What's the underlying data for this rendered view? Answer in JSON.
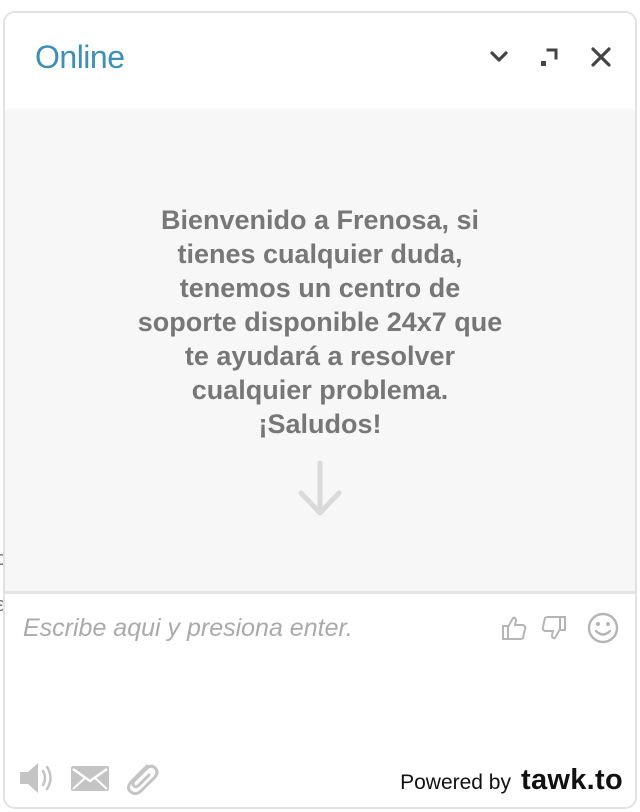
{
  "header": {
    "status": "Online"
  },
  "body": {
    "welcome_message": "Bienvenido a Frenosa, si\ntienes cualquier duda,\ntenemos un centro de\nsoporte disponible 24x7 que\nte ayudará a resolver\ncualquier problema.\n¡Saludos!"
  },
  "composer": {
    "placeholder": "Escribe aqui y presiona enter."
  },
  "footer": {
    "powered_by": "Powered by",
    "brand": "tawk.to"
  },
  "colors": {
    "status": "#3d8fb6",
    "body_bg": "#f7f7f7",
    "icon": "#b5b5b5",
    "header_icon": "#444444"
  },
  "icons": [
    "chevron-down-icon",
    "popout-icon",
    "close-icon",
    "arrow-down-icon",
    "thumbs-up-icon",
    "thumbs-down-icon",
    "smiley-icon",
    "sound-icon",
    "mail-icon",
    "attachment-icon"
  ]
}
